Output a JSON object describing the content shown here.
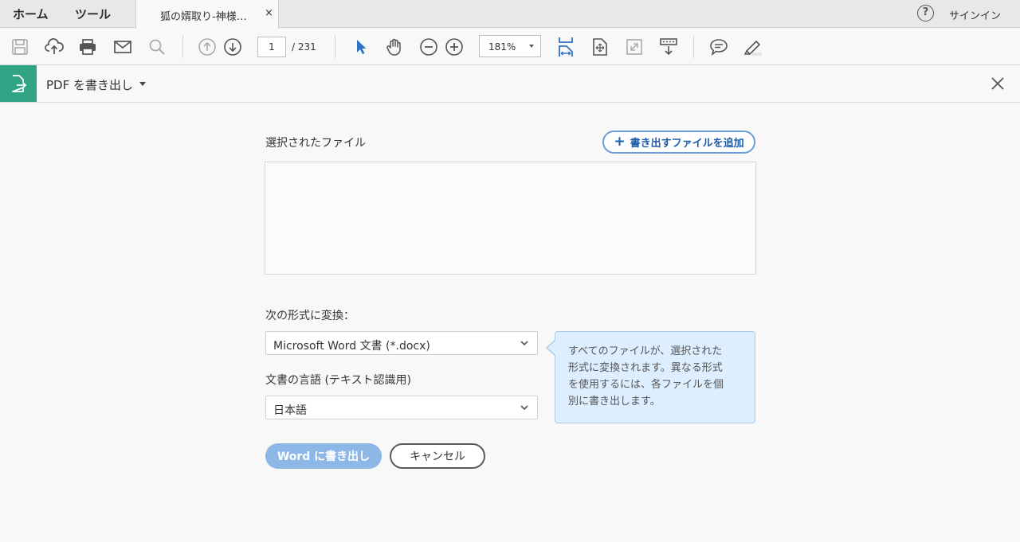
{
  "tabs": {
    "home": "ホーム",
    "tools": "ツール",
    "document": "狐の婿取り-神様…",
    "close": "×"
  },
  "topright": {
    "help": "?",
    "signin": "サインイン"
  },
  "toolbar": {
    "icons": [
      "save-icon",
      "cloud-upload-icon",
      "print-icon",
      "mail-icon",
      "search-icon",
      "page-up-icon",
      "page-down-icon",
      "select-pointer-icon",
      "hand-tool-icon",
      "zoom-out-icon",
      "zoom-in-icon",
      "fit-width-icon",
      "fit-page-icon",
      "fullscreen-icon",
      "read-mode-icon",
      "comment-icon",
      "highlight-icon"
    ],
    "page_current": "1",
    "page_total": "/ 231",
    "zoom": "181%",
    "accent": "#2f72c4"
  },
  "tool_header": {
    "title": "PDF を書き出し",
    "accent": "#30a485"
  },
  "main": {
    "selected_files_label": "選択されたファイル",
    "add_files_button": "書き出すファイルを追加",
    "convert_to_label": "次の形式に変換：",
    "format_selected": "Microsoft Word 文書 (*.docx)",
    "language_label": "文書の言語 (テキスト認識用)",
    "language_selected": "日本語",
    "tip_lines": [
      "すべてのファイルが、選択された",
      "形式に変換されます。異なる形式",
      "を使用するには、各ファイルを個",
      "別に書き出します。"
    ],
    "export_button": "Word に書き出し",
    "cancel_button": "キャンセル"
  }
}
